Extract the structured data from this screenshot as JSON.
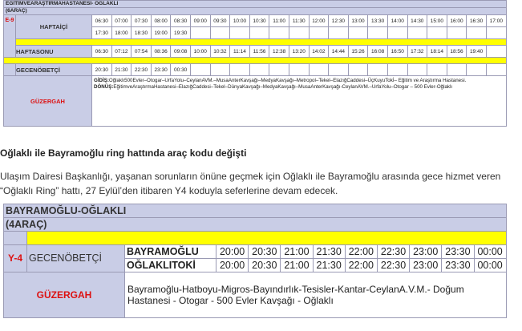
{
  "top_table": {
    "title": "EĞİTİMVEARAŞTIRMAHASTANESİ- OĞLAKLI",
    "subtitle": "(6ARAÇ)",
    "code": "E-9",
    "weekday_label": "HAFTAİÇİ",
    "weekday_times_row1": [
      "06:30",
      "07:00",
      "07:30",
      "08:00",
      "08:30",
      "09:00",
      "09:30",
      "10:00",
      "10:30",
      "11:00",
      "11:30",
      "12:00",
      "12:30",
      "13:00",
      "13:30",
      "14:00",
      "14:30",
      "15:00",
      "16:00",
      "16:30",
      "17:00"
    ],
    "weekday_times_row2": [
      "17:30",
      "18:00",
      "18:30",
      "19:00",
      "19:30",
      "",
      "",
      "",
      "",
      "",
      "",
      "",
      "",
      "",
      "",
      "",
      "",
      "",
      "",
      "",
      ""
    ],
    "weekend_label": "HAFTASONU",
    "weekend_times": [
      "06:30",
      "07:12",
      "07:54",
      "08:36",
      "09:08",
      "10:00",
      "10:32",
      "11:14",
      "11:56",
      "12:38",
      "13:20",
      "14:02",
      "14:44",
      "15:26",
      "16:08",
      "16:50",
      "17:32",
      "18:14",
      "18:56",
      "19:40",
      ""
    ],
    "night_label": "GECENÖBETÇİ",
    "night_times": [
      "20:30",
      "21:30",
      "22:30",
      "23:30",
      "00:30",
      "",
      "",
      "",
      "",
      "",
      "",
      "",
      "",
      "",
      "",
      "",
      "",
      "",
      "",
      "",
      ""
    ],
    "route_label": "GÜZERGAH",
    "route_go_label": "GİDİŞ:",
    "route_go": "Oğlaklı500Evler–Otogar–UrfaYolu–CeylanAVM.–MusaAnterKavşağı–MedyaKavşağı–Metropol–Tekel–ElazığCaddesi–ÜçKuyuTokİ– Eğitim ve Araştırma Hastanesi.",
    "route_back_label": "DÖNÜŞ:",
    "route_back": "EğitimveAraştırmaHastanesi–ElazığCaddesi–Tekel–DünyaKavşağı–MedyaKavşağı–MusaAnterKavşağı-CeylanAVM.–UrfaYolu–Otogar – 500 Evler-Oğlaklı"
  },
  "article": {
    "heading": "Oğlaklı ile Bayramoğlu ring hattında araç kodu değişti",
    "paragraph": "Ulaşım Dairesi Başkanlığı, yaşanan sorunların önüne geçmek için Oğlaklı ile Bayramoğlu arasında gece hizmet veren “Oğlaklı Ring” hattı, 27 Eylül’den itibaren Y4 koduyla seferlerine devam edecek."
  },
  "bottom_table": {
    "title": "BAYRAMOĞLU-OĞLAKLI",
    "subtitle": "(4ARAÇ)",
    "code": "Y-4",
    "night_label": "GECENÖBETÇİ",
    "stop1": "BAYRAMOĞLU",
    "stop1_times": [
      "20:00",
      "20:30",
      "21:00",
      "21:30",
      "22:00",
      "22:30",
      "23:00",
      "23:30",
      "00:00"
    ],
    "stop2": "OĞLAKLITOKİ",
    "stop2_times": [
      "20:00",
      "20:30",
      "21:00",
      "21:30",
      "22:00",
      "22:30",
      "23:00",
      "23:30",
      "00:00"
    ],
    "route_label": "GÜZERGAH",
    "route": "Bayramoğlu-Hatboyu-Migros-Bayındırlık-Tesisler-Kantar-CeylanA.V.M.- Doğum Hastanesi - Otogar - 500 Evler Kavşağı - Oğlaklı"
  }
}
